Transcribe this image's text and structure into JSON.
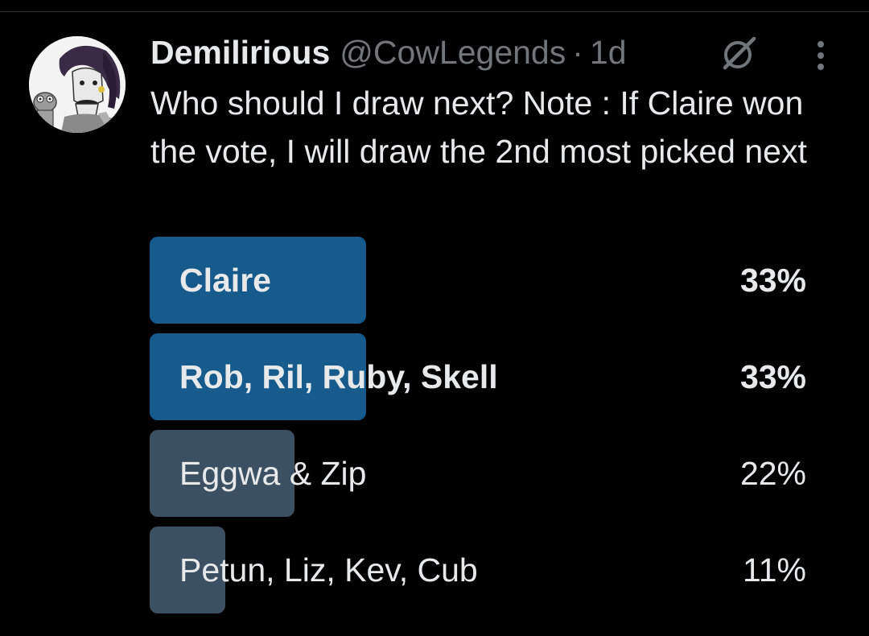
{
  "tweet": {
    "author": {
      "display_name": "Demilirious",
      "handle": "@CowLegends",
      "separator": "·",
      "time": "1d"
    },
    "text": "Who should I draw next? Note : If Claire won the vote, I will draw the 2nd most picked next",
    "icons": {
      "grok": "grok-icon",
      "more": "more-options-icon",
      "avatar": "avatar-image"
    }
  },
  "poll": {
    "options": [
      {
        "label": "Claire",
        "percent_label": "33%",
        "percent": 33,
        "winner": true
      },
      {
        "label": "Rob, Ril, Ruby, Skell",
        "percent_label": "33%",
        "percent": 33,
        "winner": true
      },
      {
        "label": "Eggwa & Zip",
        "percent_label": "22%",
        "percent": 22,
        "winner": false
      },
      {
        "label": "Petun, Liz, Kev, Cub",
        "percent_label": "11%",
        "percent": 11,
        "winner": false
      }
    ]
  },
  "colors": {
    "background": "#000000",
    "text_primary": "#e7e9ea",
    "text_secondary": "#71767b",
    "poll_winner_bar": "#165b8b",
    "poll_other_bar": "#3c5063"
  }
}
